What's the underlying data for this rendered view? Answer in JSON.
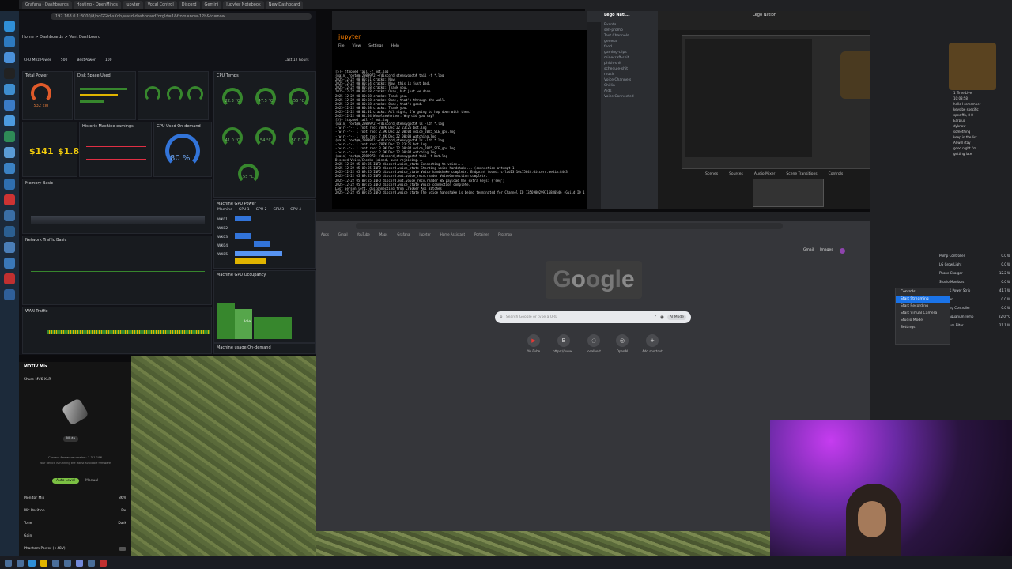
{
  "browser_tabs": [
    "Grafana - Dashboards",
    "Hosting - OpenMinds",
    "Jupyter",
    "Vocal Control",
    "Discord",
    "Gemini",
    "Jupyter Notebook",
    "New Dashboard"
  ],
  "grafana": {
    "url": "192.168.0.1:3000/d/odGGfd-sXdh/wasd-dashboard?orgId=1&from=now-12h&to=now",
    "breadcrumb": "Home > Dashboards > Vent Dashboard",
    "time_range": "Last 12 hours",
    "filters": {
      "cpu_mhz_label": "CPU Mhz Power",
      "cpu_mhz_value": "500",
      "bitrate_label": "BestPower",
      "bitrate_value": "100"
    },
    "panels": {
      "total_power": "Total Power",
      "disk_space": "Disk Space Used",
      "cpu_temps": "CPU Temps",
      "historic_earnings": "Historic Machine earnings",
      "gpu_used": "GPU Used On-demand",
      "memory_basic": "Memory Basic",
      "network_traffic": "Network Traffic Basic",
      "wan_traffic": "WAN Traffic",
      "machine_gpu_power": "Machine GPU Power",
      "machine_gpu_occupancy": "Machine GPU Occupancy",
      "machine_usage": "Machine usage On-demand"
    },
    "values": {
      "power": "532 kW",
      "earnings_total": "$141",
      "earnings_daily": "$1.82",
      "gpu_used_pct": "80 %"
    },
    "cpu_gauges": [
      {
        "label": "WK01",
        "value": "22.3 °C"
      },
      {
        "label": "WK02",
        "value": "47.5 °C"
      },
      {
        "label": "cpu1",
        "value": "55 °C"
      },
      {
        "label": "WK03",
        "value": "41.0 °C"
      },
      {
        "label": "WK04",
        "value": "54 °C"
      },
      {
        "label": "WK05",
        "value": "50.0 °C"
      },
      {
        "label": "cpu2",
        "value": "55 °C"
      }
    ],
    "gpu_columns": [
      "Machine",
      "GPU 1",
      "GPU 2",
      "GPU 3",
      "GPU 4",
      "GPU 5"
    ],
    "gpu_rows": [
      "WK01",
      "WK02",
      "WK03",
      "WK04",
      "WK05"
    ],
    "idle": "Idle"
  },
  "jupyter": {
    "title": "jupyter",
    "menu": [
      "File",
      "View",
      "Settings",
      "Help"
    ],
    "lines": [
      "[5]+  Stopped                 tail -f bot.log",
      "(main) root@m_2989972:~/discord_stemsygbot# tail -f *.log",
      "2025-12-22 00:00:51 crackz: Now.",
      "2025-12-22 00:00:54 crackz: Now, this is just bad.",
      "2025-12-22 00:00:58 crackz: Thank you.",
      "2025-12-22 00:00:58 crackz: Okay, but just we done.",
      "2025-12-22 00:00:58 crackz: Thank you.",
      "2025-12-22 00:00:58 crackz: Okay, that's through the wall.",
      "2025-12-22 00:00:58 crackz: Okay, that's good.",
      "2025-12-22 00:00:58 crackz: Thank you.",
      "2025-12-22 00:01:01 crackz: All right, I'm going to hop down with them.",
      "2025-12-22 00:04:54 Whoelsewhether: Why did you say?",
      "",
      "[5]+  Stopped                 tail -f bot.log",
      "(main) root@m_2989972:~/discord_stemsygbot# ls -lth *.log",
      "-rw-r--r-- 1 root root 787K Dec 22 23:25 bot.log",
      "-rw-r--r-- 1 root root 2.9K Dec 22 00:04 voice_2025_SCE_gov.log",
      "-rw-r--r-- 1 root root 7.4K Dec 22 00:03 watching.log",
      "(main) root@m_2989972:~/discord_stemsygbot# ls -lth *.log",
      "-rw-r--r-- 1 root root 787K Dec 22 23:25 bot.log",
      "-rw-r--r-- 1 root root 3.9K Dec 22 00:04 voice_2025_SCE_gov.log",
      "-rw-r--r-- 1 root root 2.0K Dec 22 00:04 watching.log",
      "(main) root@m_2989972:~/discord_stemsygbot# tail -f bot.log",
      "Discord Voice/Checks joined, auto-rejoining...",
      "2025-12-22 05:09:55 INFO  discord.voice_state Connecting to voice...",
      "2025-12-22 05:09:55 INFO  discord.voice_state Starting voice handshake... (connection attempt 1)",
      "2025-12-22 05:09:55 INFO  discord.voice_state Voice handshake complete. Endpoint found: c-lad13-16c7564f.discord.media:8443",
      "2025-12-22 05:09:55 INFO  discord.ext.voice_recv.reader VoiceConnection complete.",
      "2025-12-22 05:09:55 INFO  discord.ext.voice_recv.reader WS payload has extra keys: {'seq'}",
      "2025-12-22 05:09:55 INFO  discord.voice_state Voice connection complete.",
      "Last person left, disconnecting from Cracker Ass Bitches",
      "2025-12-22 05:09:55 INFO  discord.voice_state The voice handshake is being terminated for Channel ID 1356980299716880546 (Guild ID 1"
    ]
  },
  "discord": {
    "server": "Lego Nati...",
    "channels": [
      "Events",
      "self-promo",
      "Text Channels",
      "general",
      "food",
      "gaming-clips",
      "minecraft-shit",
      "phish-shit",
      "schedule-shit",
      "music",
      "Voice Channels",
      "Chillin",
      "Aids",
      "Voice Connected"
    ]
  },
  "obs": {
    "title": "Lego Nation",
    "panels": [
      "Scenes",
      "Sources",
      "Audio Mixer",
      "Scene Transitions",
      "Controls"
    ]
  },
  "chrome": {
    "bookmarks": [
      "Apps",
      "Gmail",
      "YouTube",
      "Maps",
      "Grafana",
      "Jupyter",
      "Home Assistant",
      "Portainer",
      "Proxmox"
    ],
    "top_links": [
      "Gmail",
      "Images"
    ],
    "logo": "Google",
    "search_placeholder": "Search Google or type a URL",
    "ai_mode": "AI Mode",
    "shortcuts": [
      {
        "label": "YouTube",
        "icon": "▶"
      },
      {
        "label": "https://www...",
        "icon": "B"
      },
      {
        "label": "localhost",
        "icon": "◌"
      },
      {
        "label": "OpenAI",
        "icon": "◎"
      },
      {
        "label": "Add shortcut",
        "icon": "+"
      }
    ]
  },
  "motiv": {
    "title": "MOTIV Mix",
    "device": "Shure MV6 XLR",
    "mute": "Mute",
    "firmware": "Current firmware version: 1.3.1.196",
    "firmware_note": "Your device is running the latest available firmware",
    "auto_level": "Auto Level",
    "manual": "Manual",
    "monitor_mix": "Monitor Mix",
    "monitor_mix_value": "86%",
    "mic_position": "Mic Position",
    "mic_position_value": "Far",
    "tone": "Tone",
    "tone_value": "Dark",
    "gain": "Gain",
    "phantom": "Phantom Power (+48V)"
  },
  "right_panel": {
    "rows": [
      {
        "label": "Pump Controller",
        "value": "0.0 W"
      },
      {
        "label": "LG Grow Light",
        "value": "0.0 W"
      },
      {
        "label": "Phone Charger",
        "value": "12.2 W"
      },
      {
        "label": "Studio Monitors",
        "value": "0.0 W"
      },
      {
        "label": "TP-LINK Power Strip",
        "value": "41.7 W"
      },
      {
        "label": "Heat Fan",
        "value": "0.0 W"
      },
      {
        "label": "Watering Controller",
        "value": "0.0 W"
      },
      {
        "label": "SEOA Aquarium Temp",
        "value": "22.0 °C"
      },
      {
        "label": "Aquarium Filter",
        "value": "21.1 W"
      }
    ],
    "menu": [
      "Start Streaming",
      "Start Recording",
      "Start Virtual Camera",
      "Studio Mode",
      "Settings"
    ],
    "menu_title": "Controls",
    "chat": [
      "1 Time Live",
      "10:08:58",
      "hello I remember",
      "keys be specific",
      "spec ffu, 8 8",
      "Earplug",
      "dyknow",
      "something",
      "keep in the list",
      "AI will stay",
      "good night I'm",
      "getting late"
    ]
  }
}
